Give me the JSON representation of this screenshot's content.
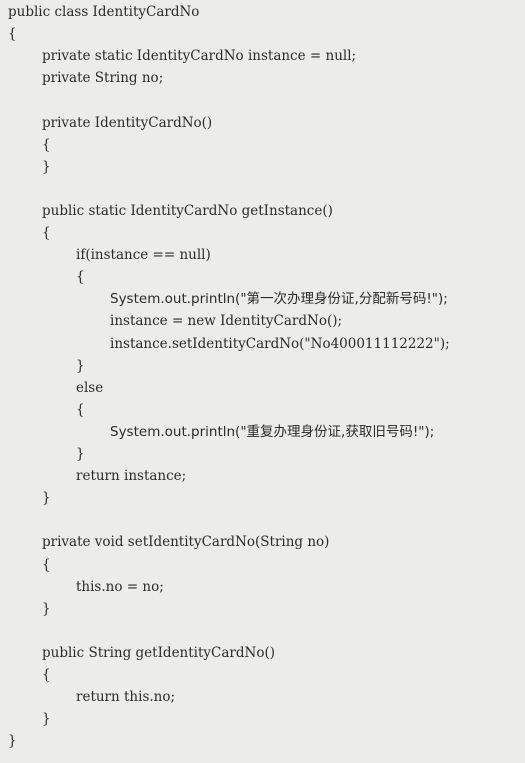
{
  "code": {
    "language": "java",
    "lines": [
      {
        "indent": 0,
        "text": "public class IdentityCardNo"
      },
      {
        "indent": 0,
        "text": "{"
      },
      {
        "indent": 1,
        "text": "private static IdentityCardNo instance = null;"
      },
      {
        "indent": 1,
        "text": "private String no;"
      },
      {
        "indent": 0,
        "text": ""
      },
      {
        "indent": 1,
        "text": "private IdentityCardNo()"
      },
      {
        "indent": 1,
        "text": "{"
      },
      {
        "indent": 1,
        "text": "}"
      },
      {
        "indent": 0,
        "text": ""
      },
      {
        "indent": 1,
        "text": "public static IdentityCardNo getInstance()"
      },
      {
        "indent": 1,
        "text": "{"
      },
      {
        "indent": 2,
        "text": "if(instance == null)"
      },
      {
        "indent": 2,
        "text": "{"
      },
      {
        "indent": 3,
        "text": "System.out.println(\"第一次办理身份证,分配新号码!\");"
      },
      {
        "indent": 3,
        "text": "instance = new IdentityCardNo();"
      },
      {
        "indent": 3,
        "text": "instance.setIdentityCardNo(\"No400011112222\");"
      },
      {
        "indent": 2,
        "text": "}"
      },
      {
        "indent": 2,
        "text": "else"
      },
      {
        "indent": 2,
        "text": "{"
      },
      {
        "indent": 3,
        "text": "System.out.println(\"重复办理身份证,获取旧号码!\");"
      },
      {
        "indent": 2,
        "text": "}"
      },
      {
        "indent": 2,
        "text": "return instance;"
      },
      {
        "indent": 1,
        "text": "}"
      },
      {
        "indent": 0,
        "text": ""
      },
      {
        "indent": 1,
        "text": "private void setIdentityCardNo(String no)"
      },
      {
        "indent": 1,
        "text": "{"
      },
      {
        "indent": 2,
        "text": "this.no = no;"
      },
      {
        "indent": 1,
        "text": "}"
      },
      {
        "indent": 0,
        "text": ""
      },
      {
        "indent": 1,
        "text": "public String getIdentityCardNo()"
      },
      {
        "indent": 1,
        "text": "{"
      },
      {
        "indent": 2,
        "text": "return this.no;"
      },
      {
        "indent": 1,
        "text": "}"
      },
      {
        "indent": 0,
        "text": "}"
      }
    ]
  }
}
